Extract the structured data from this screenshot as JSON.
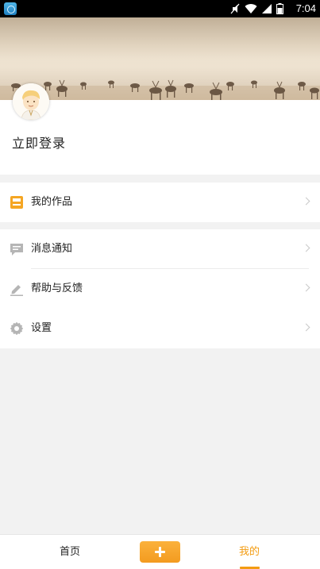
{
  "status_bar": {
    "time": "7:04",
    "icons": [
      "app-notification-icon",
      "mute-icon",
      "wifi-icon",
      "signal-icon",
      "battery-icon"
    ]
  },
  "profile": {
    "login_label": "立即登录"
  },
  "menu": {
    "works": {
      "label": "我的作品",
      "icon": "works-icon",
      "icon_color": "#f5a623"
    },
    "items": [
      {
        "label": "消息通知",
        "icon": "message-icon"
      },
      {
        "label": "帮助与反馈",
        "icon": "pencil-icon"
      },
      {
        "label": "设置",
        "icon": "gear-icon"
      }
    ]
  },
  "tab_bar": {
    "home_label": "首页",
    "add_icon": "plus-icon",
    "mine_label": "我的",
    "active_color": "#f39c12"
  }
}
